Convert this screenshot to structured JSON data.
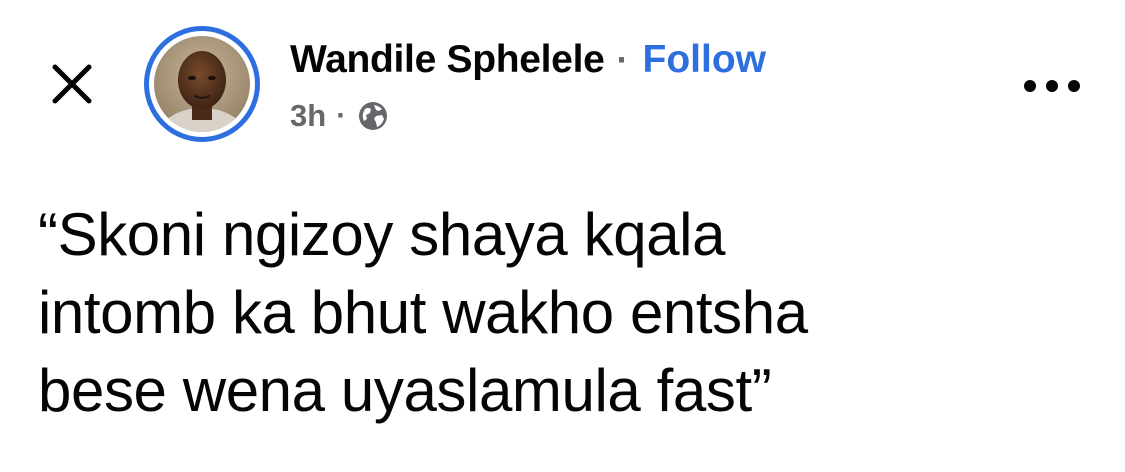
{
  "header": {
    "close_icon": "close-icon",
    "author_name": "Wandile Sphelele",
    "separator": "·",
    "follow_label": "Follow",
    "timestamp": "3h",
    "meta_separator": "·",
    "audience_icon": "globe-icon",
    "more_icon": "more-options-icon"
  },
  "post": {
    "text": "“Skoni ngizoy shaya kqala\nintomb ka bhut wakho entsha\nbese wena uyaslamula fast”"
  },
  "colors": {
    "accent": "#2e6fdf",
    "secondary_text": "#65676b",
    "primary_text": "#050505",
    "background": "#ffffff"
  }
}
